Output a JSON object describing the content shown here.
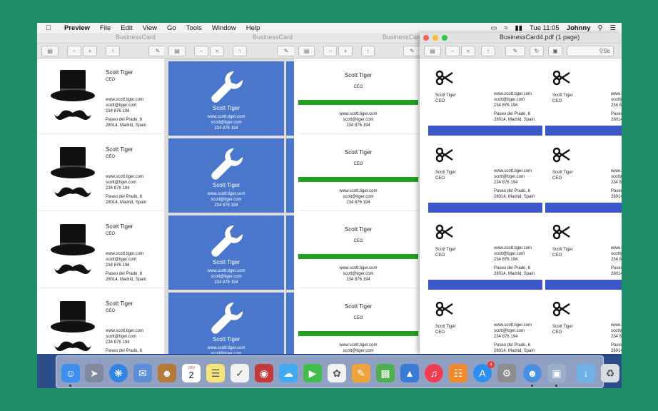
{
  "menubar": {
    "app_name": "Preview",
    "items": [
      "File",
      "Edit",
      "View",
      "Go",
      "Tools",
      "Window",
      "Help"
    ],
    "clock": "Tue 11:05",
    "user": "Johnny"
  },
  "windows": {
    "w1_title": "BusinessCard",
    "w2_title": "BusinessCard",
    "w3_title": "BusinessCard",
    "w4_title": "BusinessCard4.pdf (1 page)",
    "search_placeholder": "Se"
  },
  "card": {
    "name": "Scott Tiger",
    "role": "CEO",
    "web": "www.scott.tiger.com",
    "email": "scott@tiger.com",
    "phone": "234 876 194",
    "address1": "Paseo del Prado, 6",
    "address2": "28014, Madrid, Spain"
  },
  "calendar": {
    "month": "JUN",
    "day": "2"
  },
  "colors": {
    "blue_card": "#4a77cc",
    "green_bar": "#22a022",
    "blue_bar": "#3c58c8",
    "desktop": "#2b4d8a"
  },
  "dock_icons": [
    "finder-icon",
    "launchpad-icon",
    "safari-icon",
    "mail-icon",
    "contacts-icon",
    "calendar-icon",
    "notes-icon",
    "reminders-icon",
    "photo-booth-icon",
    "messages-icon",
    "facetime-icon",
    "photos-icon",
    "pages-icon",
    "numbers-icon",
    "keynote-icon",
    "music-icon",
    "books-icon",
    "app-store-icon",
    "system-preferences-icon",
    "user-folder-icon",
    "preview-icon",
    "downloads-folder-icon",
    "trash-icon"
  ],
  "app_store_badge": "4"
}
